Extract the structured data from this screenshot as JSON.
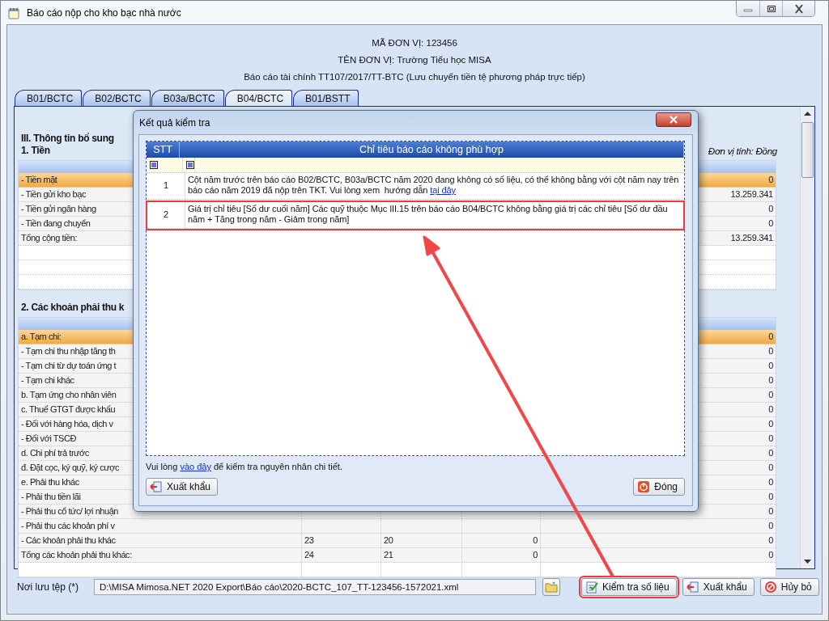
{
  "window": {
    "title": "Báo cáo nộp cho kho bạc nhà nước"
  },
  "header": {
    "unit_code": "MÃ ĐƠN VỊ: 123456",
    "unit_name": "TÊN ĐƠN VỊ: Trường Tiểu học MISA",
    "report_name": "Báo cáo tài chính TT107/2017/TT-BTC (Lưu chuyển tiền tệ phương pháp trực tiếp)"
  },
  "tabs": [
    {
      "label": "B01/BCTC",
      "selected": false
    },
    {
      "label": "B02/BCTC",
      "selected": false
    },
    {
      "label": "B03a/BCTC",
      "selected": false
    },
    {
      "label": "B04/BCTC",
      "selected": true
    },
    {
      "label": "B01/BSTT",
      "selected": false
    }
  ],
  "report": {
    "section_title": "III. Thông tin bổ sung",
    "groups": [
      {
        "title": "1. Tiền",
        "unit": "Đơn vị tính: Đồng",
        "rows": [
          {
            "label": "- Tiền mặt",
            "amount": "0",
            "selected": true
          },
          {
            "label": "- Tiền gửi kho bạc",
            "amount": "13.259.341",
            "selected": false
          },
          {
            "label": "- Tiền gửi ngân hàng",
            "amount": "0",
            "selected": false
          },
          {
            "label": "- Tiền đang chuyển",
            "amount": "0",
            "selected": false
          },
          {
            "label": "Tổng cộng tiền:",
            "amount": "13.259.341",
            "selected": false
          }
        ]
      },
      {
        "title": "2. Các khoản phải thu k",
        "rows": [
          {
            "label": "a. Tạm chi:",
            "amount": "0",
            "selected": true
          },
          {
            "label": "- Tạm chi thu nhập tăng th",
            "amount": "0",
            "selected": false
          },
          {
            "label": "- Tạm chi từ dự toán ứng t",
            "amount": "0",
            "selected": false
          },
          {
            "label": "- Tạm chi khác",
            "amount": "0",
            "selected": false
          },
          {
            "label": "b. Tạm ứng cho nhân viên",
            "amount": "0",
            "selected": false
          },
          {
            "label": "c. Thuế GTGT được khấu",
            "amount": "0",
            "selected": false
          },
          {
            "label": "- Đối với hàng hóa, dịch v",
            "amount": "0",
            "selected": false
          },
          {
            "label": "- Đối với TSCĐ",
            "amount": "0",
            "selected": false
          },
          {
            "label": "d. Chi phí trả trước",
            "amount": "0",
            "selected": false
          },
          {
            "label": "đ. Đặt cọc, ký quỹ, ký cược",
            "amount": "0",
            "selected": false
          },
          {
            "label": "e. Phải thu khác",
            "amount": "0",
            "selected": false
          },
          {
            "label": "- Phải thu tiền lãi",
            "amount": "0",
            "selected": false
          },
          {
            "label": "- Phải thu cổ tức/ lợi nhuận",
            "amount": "0",
            "selected": false
          },
          {
            "label": "- Phải thu các khoản phí v",
            "amount": "0",
            "selected": false
          },
          {
            "label": "- Các khoản phải thu khác",
            "col_2": "23",
            "col_3": "20",
            "col_4": "0",
            "amount": "0",
            "selected": false
          },
          {
            "label": "Tổng các khoản phải thu khác:",
            "col_2": "24",
            "col_3": "21",
            "col_4": "0",
            "amount": "0",
            "selected": false
          }
        ]
      }
    ]
  },
  "dialog": {
    "title": "Kết quả kiểm tra",
    "columns": [
      "STT",
      "Chỉ tiêu báo cáo không phù hợp"
    ],
    "rows": [
      {
        "stt": "1",
        "text": "Cột năm trước trên báo cáo B02/BCTC, B03a/BCTC năm 2020 đang không có số liệu, có thể không bằng với cột năm nay trên báo cáo năm 2019 đã nộp trên TKT. Vui lòng xem  hướng dẫn ",
        "link": "tại đây",
        "highlighted": false
      },
      {
        "stt": "2",
        "text": "Giá trị chỉ tiêu [Số dư cuối năm] Các quỹ thuộc Mục III.15 trên báo cáo B04/BCTC không bằng giá trị các chỉ tiêu [Số dư đầu năm + Tăng trong năm - Giảm trong năm]",
        "highlighted": true
      }
    ],
    "note": {
      "before": "Vui lòng ",
      "link": "vào đây",
      "after": " để kiểm tra nguyên nhân chi tiết."
    },
    "export_button": "Xuất khẩu",
    "close_button": "Đóng"
  },
  "footer": {
    "path_label": "Nơi lưu tệp (*)",
    "path_value": "D:\\MISA Mimosa.NET 2020 Export\\Báo cáo\\2020-BCTC_107_TT-123456-1572021.xml",
    "buttons": [
      {
        "kind": "check",
        "label": "Kiểm tra số liệu",
        "highlighted": true
      },
      {
        "kind": "export",
        "label": "Xuất khẩu",
        "highlighted": false
      },
      {
        "kind": "cancel",
        "label": "Hủy bỏ",
        "highlighted": false
      }
    ]
  }
}
